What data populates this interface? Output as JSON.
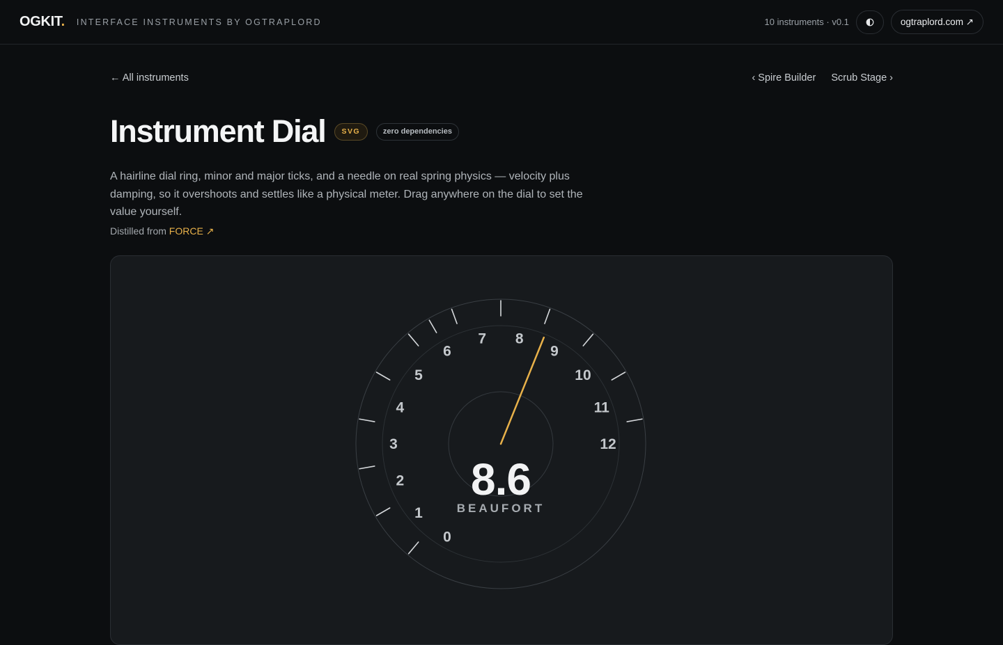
{
  "header": {
    "logo": "OGKIT",
    "logo_dot": ".",
    "tagline": "INTERFACE INSTRUMENTS BY OGTRAPLORD",
    "meta": "10 instruments · v0.1",
    "theme_icon": "contrast-icon",
    "site_link": "ogtraplord.com ↗"
  },
  "nav": {
    "back": "← All instruments",
    "prev": "‹ Spire Builder",
    "next": "Scrub Stage ›"
  },
  "page": {
    "title": "Instrument Dial",
    "badge_primary": "SVG",
    "badge_secondary": "zero dependencies",
    "description": "A hairline dial ring, minor and major ticks, and a needle on real spring physics — velocity plus damping, so it overshoots and settles like a physical meter. Drag anywhere on the dial to set the value yourself.",
    "distilled_prefix": "Distilled from",
    "distilled_link": "FORCE ↗"
  },
  "dial": {
    "value": 8.6,
    "value_label": "8.6",
    "unit": "BEAUFORT",
    "min": 0,
    "max": 12,
    "tick_labels": [
      "0",
      "1",
      "2",
      "3",
      "4",
      "5",
      "6",
      "7",
      "8",
      "9",
      "10",
      "11",
      "12"
    ],
    "colors": {
      "needle": "#e8b14a",
      "ring": "#3a3f44",
      "tick": "#d5d8db",
      "label": "#c4c8cc"
    }
  }
}
